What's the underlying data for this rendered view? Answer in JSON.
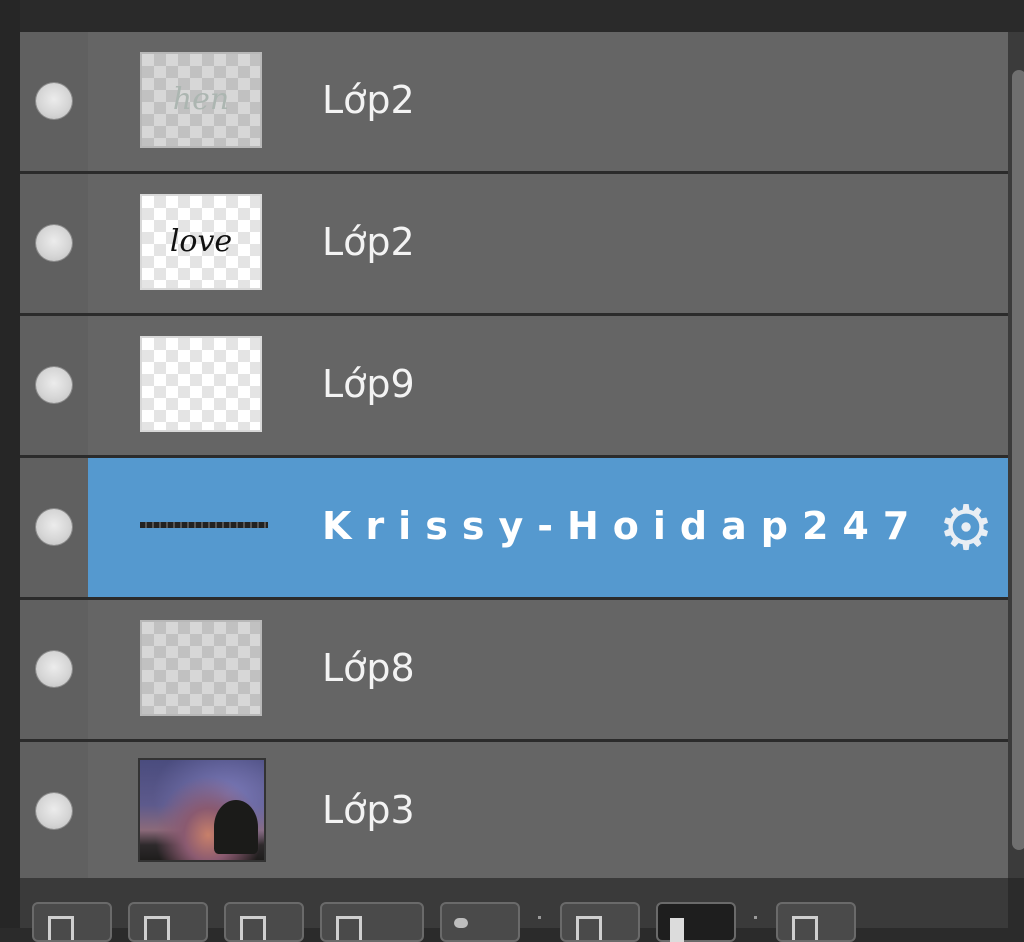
{
  "layers": [
    {
      "name": "Lớp2",
      "thumb_text": "hen",
      "thumb_style": "ghost",
      "selected": false
    },
    {
      "name": "Lớp2",
      "thumb_text": "love",
      "thumb_style": "ink",
      "selected": false
    },
    {
      "name": "Lớp9",
      "thumb_text": "",
      "thumb_style": "plain",
      "selected": false
    },
    {
      "name": "Krissy-Hoidap247",
      "thumb_text": "",
      "thumb_style": "text-layer",
      "selected": true,
      "icon": "gear-icon"
    },
    {
      "name": "Lớp8",
      "thumb_text": "",
      "thumb_style": "plain",
      "selected": false
    },
    {
      "name": "Lớp3",
      "thumb_text": "",
      "thumb_style": "photo",
      "selected": false
    }
  ],
  "colors": {
    "selected_row": "#5599cf",
    "row_background": "#656565",
    "panel_background": "#2b2b2b"
  },
  "toolbar_icons": [
    "new-layer-icon",
    "duplicate-layer-icon",
    "merge-layer-icon",
    "layer-folder-icon",
    "mask-icon",
    "clipping-icon",
    "lock-icon",
    "delete-layer-icon"
  ]
}
